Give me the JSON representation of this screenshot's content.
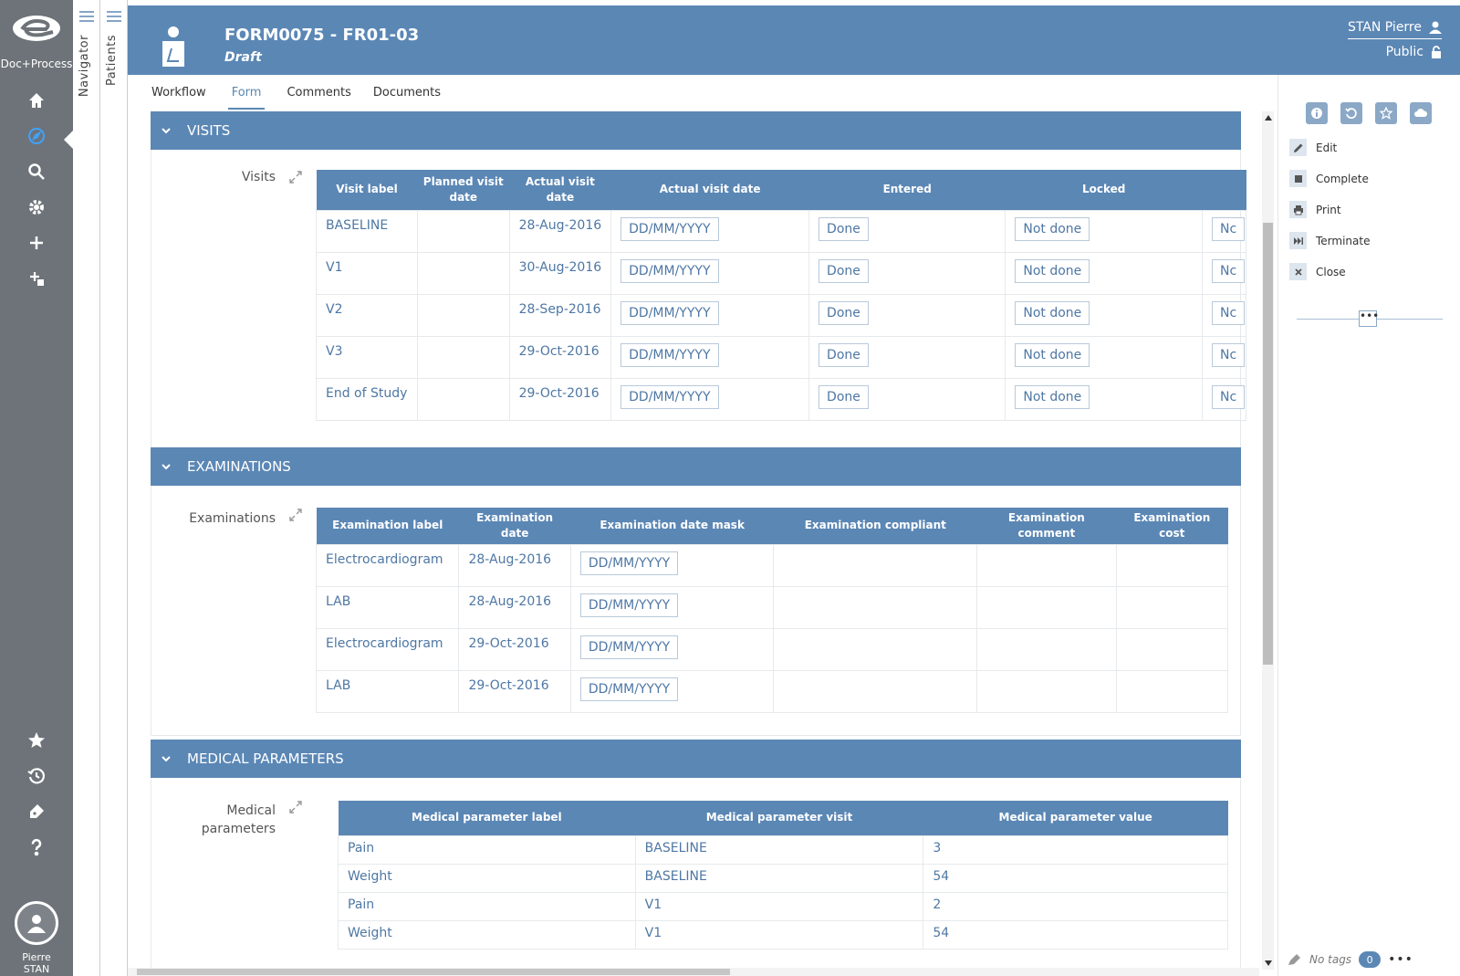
{
  "app": {
    "logo_text": "Doc+Process",
    "user_first": "Pierre",
    "user_last": "STAN"
  },
  "rail": {
    "items": [
      "home-icon",
      "compass-icon",
      "search-icon",
      "gear-icon",
      "plus-icon",
      "add-document-icon",
      "star-icon",
      "history-icon",
      "tag-icon",
      "help-icon"
    ],
    "accent": "#3ea3ff"
  },
  "vtabs": {
    "navigator": "Navigator",
    "patients": "Patients"
  },
  "header": {
    "title": "FORM0075 - FR01-03",
    "status": "Draft",
    "user": "STAN Pierre",
    "visibility": "Public",
    "color": "#5b87b5"
  },
  "tabs": [
    {
      "label": "Workflow"
    },
    {
      "label": "Form"
    },
    {
      "label": "Comments"
    },
    {
      "label": "Documents"
    }
  ],
  "visits": {
    "section_title": "VISITS",
    "field_label": "Visits",
    "columns": [
      "Visit label",
      "Planned visit date",
      "Actual visit",
      "Actual visit date",
      "Entered",
      "Locked"
    ],
    "actual_col_line2": "date",
    "rows": [
      {
        "label": "BASELINE",
        "planned": "",
        "actual": "28-Aug-2016",
        "mask": "DD/MM/YYYY",
        "entered": "Done",
        "locked": "Not done",
        "next": "Nc"
      },
      {
        "label": "V1",
        "planned": "",
        "actual": "30-Aug-2016",
        "mask": "DD/MM/YYYY",
        "entered": "Done",
        "locked": "Not done",
        "next": "Nc"
      },
      {
        "label": "V2",
        "planned": "",
        "actual": "28-Sep-2016",
        "mask": "DD/MM/YYYY",
        "entered": "Done",
        "locked": "Not done",
        "next": "Nc"
      },
      {
        "label": "V3",
        "planned": "",
        "actual": "29-Oct-2016",
        "mask": "DD/MM/YYYY",
        "entered": "Done",
        "locked": "Not done",
        "next": "Nc"
      },
      {
        "label": "End of Study",
        "planned": "",
        "actual": "29-Oct-2016",
        "mask": "DD/MM/YYYY",
        "entered": "Done",
        "locked": "Not done",
        "next": "Nc"
      }
    ]
  },
  "examinations": {
    "section_title": "EXAMINATIONS",
    "field_label": "Examinations",
    "columns": [
      "Examination label",
      "Examination date",
      "Examination date mask",
      "Examination compliant",
      "Examination comment",
      "Examination cost"
    ],
    "rows": [
      {
        "label": "Electrocardiogram",
        "date": "28-Aug-2016",
        "mask": "DD/MM/YYYY",
        "compliant": "",
        "comment": "",
        "cost": ""
      },
      {
        "label": "LAB",
        "date": "28-Aug-2016",
        "mask": "DD/MM/YYYY",
        "compliant": "",
        "comment": "",
        "cost": ""
      },
      {
        "label": "Electrocardiogram",
        "date": "29-Oct-2016",
        "mask": "DD/MM/YYYY",
        "compliant": "",
        "comment": "",
        "cost": ""
      },
      {
        "label": "LAB",
        "date": "29-Oct-2016",
        "mask": "DD/MM/YYYY",
        "compliant": "",
        "comment": "",
        "cost": ""
      }
    ]
  },
  "medical": {
    "section_title": "MEDICAL PARAMETERS",
    "field_label_1": "Medical",
    "field_label_2": "parameters",
    "columns": [
      "Medical parameter label",
      "Medical parameter visit",
      "Medical parameter value"
    ],
    "rows": [
      {
        "label": "Pain",
        "visit": "BASELINE",
        "value": "3"
      },
      {
        "label": "Weight",
        "visit": "BASELINE",
        "value": "54"
      },
      {
        "label": "Pain",
        "visit": "V1",
        "value": "2"
      },
      {
        "label": "Weight",
        "visit": "V1",
        "value": "54"
      }
    ]
  },
  "right_panel": {
    "top_icons": [
      "info-icon",
      "refresh-icon",
      "star-icon",
      "cloud-icon"
    ],
    "actions": [
      {
        "label": "Edit",
        "icon": "pencil-icon"
      },
      {
        "label": "Complete",
        "icon": "square-icon"
      },
      {
        "label": "Print",
        "icon": "printer-icon"
      },
      {
        "label": "Terminate",
        "icon": "skip-forward-icon"
      },
      {
        "label": "Close",
        "icon": "close-icon"
      }
    ],
    "more": "•••",
    "tags_label": "No tags",
    "tags_count": "0",
    "tags_more": "•••"
  }
}
